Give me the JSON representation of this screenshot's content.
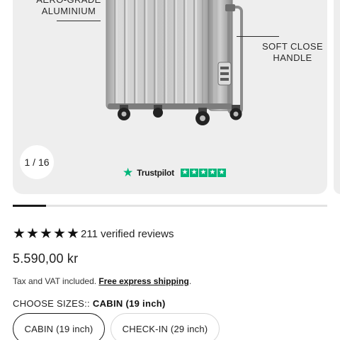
{
  "gallery": {
    "callout_left": "AERO-GRADE ALUMINIUM",
    "callout_right": "SOFT CLOSE HANDLE",
    "counter": "1 / 16",
    "trustpilot_label": "Trustpilot",
    "trustpilot_rating_stars": 5,
    "progress_fraction": 0.0625
  },
  "reviews": {
    "rating_stars": 5,
    "text": "211 verified reviews"
  },
  "price": "5.590,00 kr",
  "tax": {
    "prefix": "Tax and VAT included.",
    "link": "Free express shipping",
    "suffix": "."
  },
  "sizes": {
    "label": "CHOOSE SIZES::",
    "selected": "CABIN (19 inch)",
    "options": [
      "CABIN (19 inch)",
      "CHECK-IN (29 inch)"
    ]
  },
  "colors": {
    "trustpilot_green": "#00b67a",
    "progress": "#1a1a1a",
    "gallery_bg": "#eeeeee"
  }
}
